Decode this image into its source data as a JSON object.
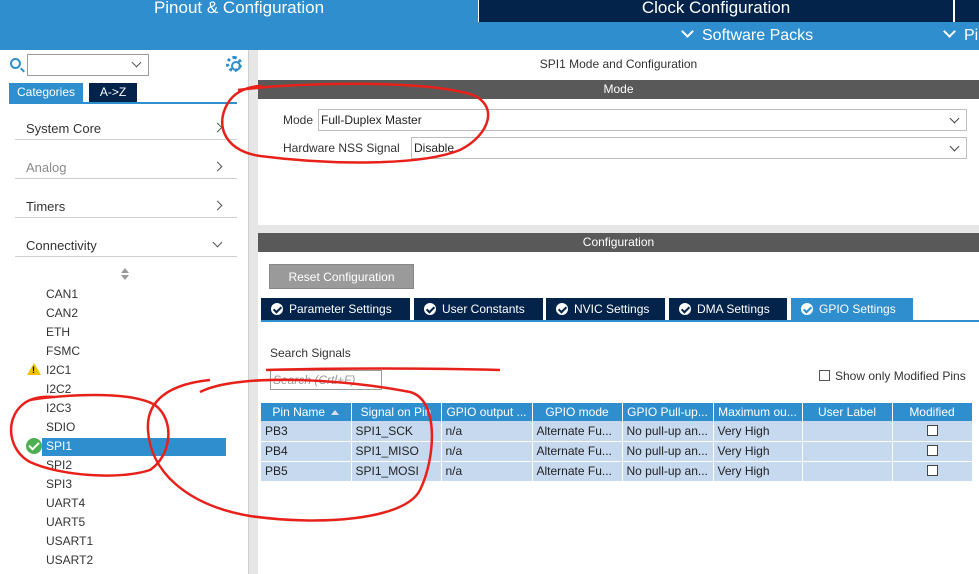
{
  "header": {
    "tabs": [
      {
        "label": "Pinout & Configuration",
        "active": true
      },
      {
        "label": "Clock Configuration",
        "active": false
      }
    ],
    "software_packs": "Software Packs",
    "pinout_more": "Pi"
  },
  "sidebar": {
    "search_value": "",
    "categories_tab": "Categories",
    "az_tab": "A->Z",
    "groups": [
      {
        "label": "System Core",
        "enabled": true,
        "expanded": false
      },
      {
        "label": "Analog",
        "enabled": false,
        "expanded": false
      },
      {
        "label": "Timers",
        "enabled": true,
        "expanded": false
      },
      {
        "label": "Connectivity",
        "enabled": true,
        "expanded": true
      }
    ],
    "peripherals": [
      {
        "label": "CAN1",
        "status": "none"
      },
      {
        "label": "CAN2",
        "status": "none"
      },
      {
        "label": "ETH",
        "status": "none"
      },
      {
        "label": "FSMC",
        "status": "none"
      },
      {
        "label": "I2C1",
        "status": "warning"
      },
      {
        "label": "I2C2",
        "status": "none"
      },
      {
        "label": "I2C3",
        "status": "none"
      },
      {
        "label": "SDIO",
        "status": "none"
      },
      {
        "label": "SPI1",
        "status": "configured",
        "selected": true
      },
      {
        "label": "SPI2",
        "status": "none"
      },
      {
        "label": "SPI3",
        "status": "none"
      },
      {
        "label": "UART4",
        "status": "none"
      },
      {
        "label": "UART5",
        "status": "none"
      },
      {
        "label": "USART1",
        "status": "none"
      },
      {
        "label": "USART2",
        "status": "none"
      }
    ]
  },
  "mode_panel": {
    "title": "SPI1 Mode and Configuration",
    "header": "Mode",
    "mode_label": "Mode",
    "mode_value": "Full-Duplex Master",
    "nss_label": "Hardware NSS Signal",
    "nss_value": "Disable"
  },
  "config_panel": {
    "header": "Configuration",
    "reset_button": "Reset Configuration",
    "tabs": [
      {
        "label": "Parameter Settings",
        "active": false
      },
      {
        "label": "User Constants",
        "active": false
      },
      {
        "label": "NVIC Settings",
        "active": false
      },
      {
        "label": "DMA Settings",
        "active": false
      },
      {
        "label": "GPIO Settings",
        "active": true
      }
    ],
    "search_label": "Search Signals",
    "search_placeholder": "Search (Crtl+F)",
    "show_modified_label": "Show only Modified Pins",
    "show_modified_checked": false,
    "table": {
      "columns": [
        "Pin Name",
        "Signal on Pin",
        "GPIO output ...",
        "GPIO mode",
        "GPIO Pull-up...",
        "Maximum ou...",
        "User Label",
        "Modified"
      ],
      "rows": [
        {
          "pin": "PB3",
          "signal": "SPI1_SCK",
          "output": "n/a",
          "mode": "Alternate Fu...",
          "pull": "No pull-up an...",
          "speed": "Very High",
          "label": "",
          "modified": false
        },
        {
          "pin": "PB4",
          "signal": "SPI1_MISO",
          "output": "n/a",
          "mode": "Alternate Fu...",
          "pull": "No pull-up an...",
          "speed": "Very High",
          "label": "",
          "modified": false
        },
        {
          "pin": "PB5",
          "signal": "SPI1_MOSI",
          "output": "n/a",
          "mode": "Alternate Fu...",
          "pull": "No pull-up an...",
          "speed": "Very High",
          "label": "",
          "modified": false
        }
      ]
    }
  },
  "colors": {
    "accent": "#2e8ece",
    "dark_navy": "#03234b",
    "section_header": "#595959",
    "row_fill": "#c6d9ef",
    "annotation_red": "#e8201a"
  }
}
